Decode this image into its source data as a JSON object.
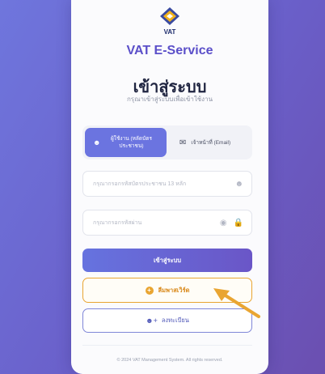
{
  "brand": {
    "logo_text": "VAT",
    "name": "VAT E-Service"
  },
  "header": {
    "title": "เข้าสู่ระบบ",
    "subtitle": "กรุณาเข้าสู่ระบบเพื่อเข้าใช้งาน"
  },
  "tabs": [
    {
      "label": "ผู้ใช้งาน (หลัดบัตรประชาชน)",
      "icon": "user-icon",
      "active": true
    },
    {
      "label": "เจ้าหน้าที่ (Email)",
      "icon": "mail-icon",
      "active": false
    }
  ],
  "fields": {
    "id": {
      "placeholder": "กรุณากรอกรหัสบัตรประชาชน 13 หลัก",
      "icon": "user-icon",
      "value": ""
    },
    "password": {
      "placeholder": "กรุณากรอกรหัสผ่าน",
      "icons": [
        "eye-icon",
        "lock-icon"
      ],
      "value": ""
    }
  },
  "buttons": {
    "login": "เข้าสู่ระบบ",
    "forgot": "ลืมพาสเวิร์ด",
    "register": "ลงทะเบียน"
  },
  "footer": "© 2024 VAT Management System. All rights reserved.",
  "colors": {
    "accent": "#6b74e0",
    "brand_text": "#5b4fc9",
    "forgot_border": "#e9a532",
    "register_border": "#7f86d8",
    "arrow": "#e9a532"
  }
}
